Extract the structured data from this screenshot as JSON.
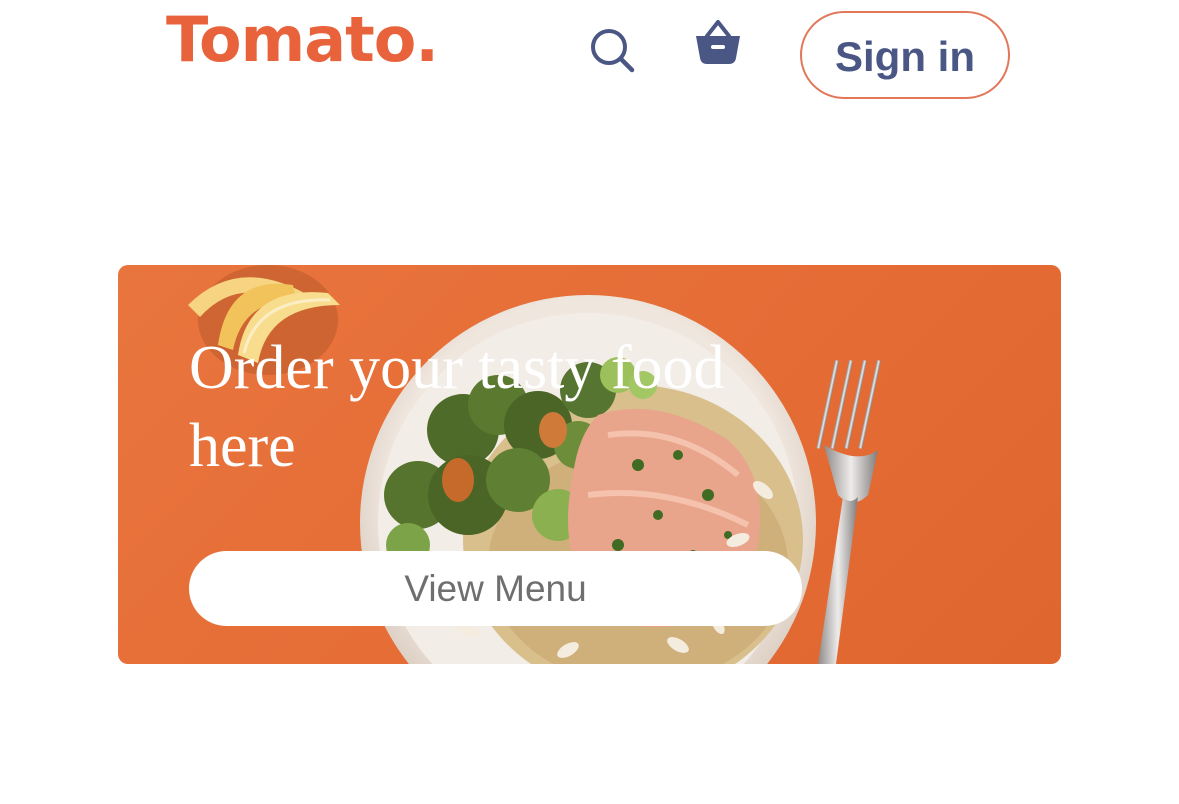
{
  "header": {
    "logo": "Tomato.",
    "search_icon": "search-icon",
    "basket_icon": "basket-icon",
    "signin_label": "Sign in"
  },
  "hero": {
    "title": "Order your tasty food here",
    "button_label": "View Menu"
  },
  "colors": {
    "brand": "#e8633b",
    "nav_text": "#4a5785",
    "hero_bg": "#e56c35",
    "button_bg": "#ffffff",
    "button_text": "#6f6f6f"
  }
}
